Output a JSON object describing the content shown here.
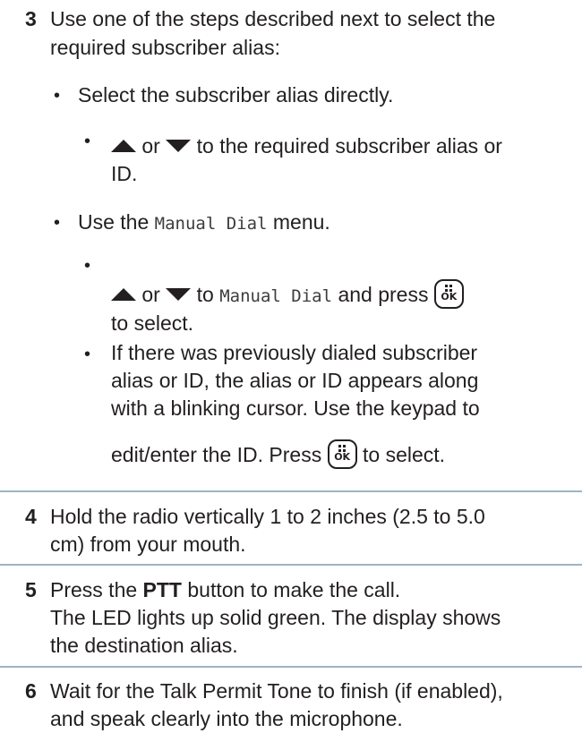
{
  "steps": {
    "s3": {
      "number": "3",
      "line1": "Use one of the steps described next to select the",
      "line2": "required subscriber alias:",
      "opt1": "Select the subscriber alias directly.",
      "opt1_sub_mid": "or",
      "opt1_sub_end": "to the required subscriber alias or",
      "opt1_sub_line2": "ID.",
      "opt2_pre": "Use the",
      "opt2_menu": "Manual Dial",
      "opt2_post": "menu.",
      "opt2_a_or": "or",
      "opt2_a_to": "to",
      "opt2_a_menu": "Manual Dial",
      "opt2_a_press": "and press",
      "opt2_a_line2": "to select.",
      "opt2_b_line1": "If there was previously dialed subscriber",
      "opt2_b_line2": "alias or ID, the alias or ID appears along",
      "opt2_b_line3": "with a blinking cursor. Use the keypad to",
      "opt2_b_line4_pre": "edit/enter the ID. Press",
      "opt2_b_line4_post": "to select."
    },
    "s4": {
      "number": "4",
      "line1": "Hold the radio vertically 1 to 2 inches (2.5 to 5.0",
      "line2": "cm) from your mouth."
    },
    "s5": {
      "number": "5",
      "line1_pre": "Press the",
      "line1_bold": "PTT",
      "line1_post": "button to make the call.",
      "line2": "The LED lights up solid green. The display shows",
      "line3": "the destination alias."
    },
    "s6": {
      "number": "6",
      "line1": "Wait for the Talk Permit Tone to finish (if enabled),",
      "line2": "and speak clearly into the microphone."
    }
  },
  "bullet_char": "•",
  "key_label": "OK",
  "icons": [
    "up-arrow-icon",
    "down-arrow-icon",
    "ok-menu-key-icon"
  ]
}
